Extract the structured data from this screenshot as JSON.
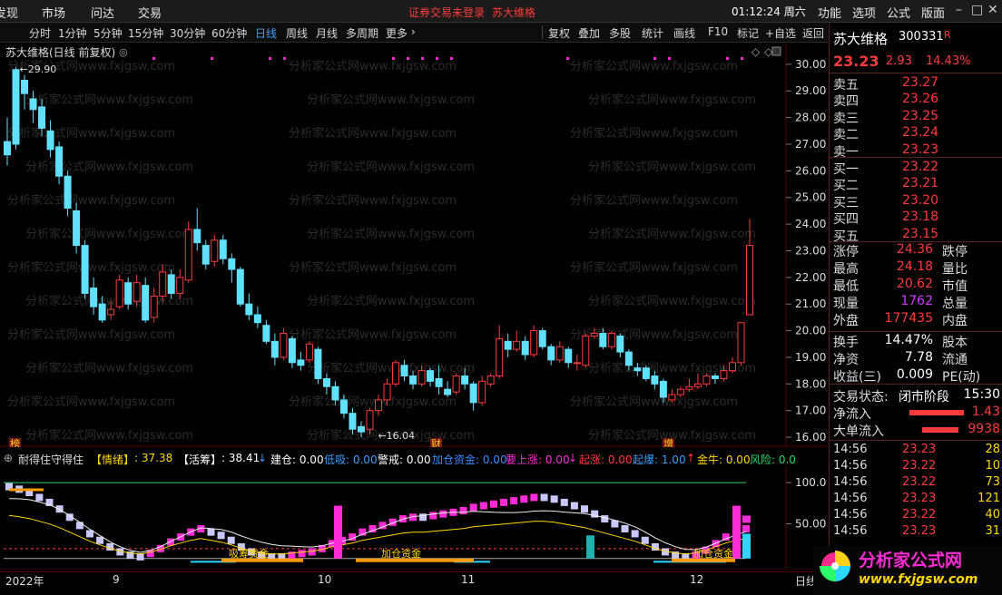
{
  "topbar": {
    "menus": [
      "发现",
      "市场",
      "问达",
      "交易"
    ],
    "center_login": "证券交易未登录",
    "center_stock": "苏大维格",
    "time": "01:12:24 周六",
    "right_menus": [
      "功能",
      "选项",
      "公式",
      "版面"
    ],
    "window_controls": [
      "minimize-icon",
      "maximize-icon",
      "close-icon"
    ]
  },
  "periods": [
    "分时",
    "1分钟",
    "5分钟",
    "15分钟",
    "30分钟",
    "60分钟",
    "日线",
    "周线",
    "月线",
    "多周期",
    "更多"
  ],
  "active_period": "日线",
  "tools": [
    "复权",
    "叠加",
    "多股",
    "统计",
    "画线",
    "F10",
    "标记",
    "+自选",
    "返回"
  ],
  "chart": {
    "title": "苏大维格(日线 前复权)",
    "high_label": "29.90",
    "low_label": "16.04",
    "y_ticks": [
      "30.00",
      "29.00",
      "28.00",
      "27.00",
      "26.00",
      "25.00",
      "24.00",
      "23.00",
      "22.00",
      "21.00",
      "20.00",
      "19.00",
      "18.00",
      "17.00",
      "16.00"
    ],
    "event_markers": [
      "榜",
      "财",
      "增"
    ],
    "watermark": "分析家公式网www.fxjgsw.com"
  },
  "indicator": {
    "name": "耐得住守得住",
    "qingxu_label": "【情绪】",
    "qingxu_value": ": 37.38",
    "huochou_label": "【活筹】",
    "huochou_value": ": 38.41",
    "jiancang": "建仓: 0.00",
    "dixi": "低吸: 0.00",
    "jingjie": "警戒: 0.00",
    "zhuli": "加仓资金: 0.00",
    "yaoshangzhang": "要上涨: 0.00",
    "qizhang": "起涨: 0.00",
    "qibao": "起爆: 1.00",
    "jinniu": "金牛: 0.00",
    "fengxian": "风险: 0.0",
    "y_ticks": [
      "100.0",
      "50.00"
    ],
    "annotations": [
      "吸筹资金",
      "加仓资金",
      "加仓资金"
    ]
  },
  "xaxis": {
    "labels": [
      "2022年",
      "9",
      "10",
      "11",
      "12"
    ],
    "right_label": "日线"
  },
  "quote": {
    "name": "苏大维格",
    "code": "300331",
    "flag": "R",
    "price": "23.23",
    "change": "2.93",
    "pct": "14.43%",
    "asks": [
      {
        "label": "卖五",
        "price": "23.27"
      },
      {
        "label": "卖四",
        "price": "23.26"
      },
      {
        "label": "卖三",
        "price": "23.25"
      },
      {
        "label": "卖二",
        "price": "23.24"
      },
      {
        "label": "卖一",
        "price": "23.23"
      }
    ],
    "bids": [
      {
        "label": "买一",
        "price": "23.22"
      },
      {
        "label": "买二",
        "price": "23.21"
      },
      {
        "label": "买三",
        "price": "23.20"
      },
      {
        "label": "买四",
        "price": "23.18"
      },
      {
        "label": "买五",
        "price": "23.15"
      }
    ],
    "stats": [
      {
        "label": "涨停",
        "value": "24.36",
        "label2": "跌停",
        "color": "red"
      },
      {
        "label": "最高",
        "value": "24.18",
        "label2": "量比",
        "color": "red"
      },
      {
        "label": "最低",
        "value": "20.62",
        "label2": "市值",
        "color": "red"
      },
      {
        "label": "现量",
        "value": "1762",
        "label2": "总量",
        "color": "purple"
      },
      {
        "label": "外盘",
        "value": "177435",
        "label2": "内盘",
        "color": "red"
      }
    ],
    "stats2": [
      {
        "label": "换手",
        "value": "14.47%",
        "label2": "股本"
      },
      {
        "label": "净资",
        "value": "7.78",
        "label2": "流通"
      },
      {
        "label": "收益(三)",
        "value": "0.009",
        "label2": "PE(动)"
      }
    ],
    "trade_status_label": "交易状态:",
    "trade_status": "闭市阶段",
    "trade_time": "15:30",
    "net_inflow_label": "净流入",
    "net_inflow": "1.43",
    "big_inflow_label": "大单流入",
    "big_inflow": "9938",
    "ticks": [
      {
        "t": "14:56",
        "p": "23.23",
        "q": "28"
      },
      {
        "t": "14:56",
        "p": "23.22",
        "q": "10"
      },
      {
        "t": "14:56",
        "p": "23.22",
        "q": "73"
      },
      {
        "t": "14:56",
        "p": "23.23",
        "q": "121"
      },
      {
        "t": "14:56",
        "p": "23.22",
        "q": "40"
      },
      {
        "t": "14:56",
        "p": "23.23",
        "q": "31"
      }
    ]
  },
  "logo": {
    "text": "分析家公式网",
    "url": "www.fxjgsw.com"
  },
  "colors": {
    "up": "#ff3b3b",
    "down": "#5fe1ff",
    "accent": "#3aa0ff",
    "magenta": "#ff2bd6",
    "lavender": "#c8c8ff"
  },
  "chart_data": {
    "type": "candlestick",
    "y_range": [
      15.9,
      30.2
    ],
    "candles": [
      [
        27.1,
        26.6,
        28.0,
        26.2
      ],
      [
        29.8,
        27.0,
        29.9,
        26.8
      ],
      [
        29.4,
        28.9,
        29.6,
        28.3
      ],
      [
        28.7,
        28.3,
        29.0,
        27.8
      ],
      [
        28.4,
        27.6,
        28.7,
        27.3
      ],
      [
        27.5,
        26.8,
        27.9,
        26.5
      ],
      [
        26.9,
        25.8,
        27.1,
        25.5
      ],
      [
        25.8,
        24.6,
        26.0,
        24.3
      ],
      [
        24.5,
        23.2,
        24.8,
        22.9
      ],
      [
        23.2,
        21.4,
        23.4,
        21.2
      ],
      [
        21.6,
        20.9,
        22.0,
        20.6
      ],
      [
        21.0,
        20.4,
        21.3,
        20.3
      ],
      [
        20.6,
        20.8,
        21.1,
        20.4
      ],
      [
        20.9,
        21.9,
        22.1,
        20.8
      ],
      [
        21.8,
        21.0,
        22.0,
        20.8
      ],
      [
        21.1,
        21.8,
        22.1,
        20.9
      ],
      [
        21.7,
        20.4,
        22.0,
        20.3
      ],
      [
        20.5,
        21.3,
        21.6,
        20.3
      ],
      [
        21.3,
        22.2,
        22.5,
        21.1
      ],
      [
        22.1,
        21.4,
        22.3,
        21.2
      ],
      [
        21.4,
        22.0,
        22.3,
        21.2
      ],
      [
        21.9,
        23.8,
        24.1,
        21.8
      ],
      [
        23.8,
        23.3,
        24.6,
        23.0
      ],
      [
        23.2,
        22.5,
        23.4,
        22.3
      ],
      [
        22.6,
        23.4,
        23.6,
        22.4
      ],
      [
        23.4,
        22.7,
        23.6,
        22.5
      ],
      [
        22.7,
        22.3,
        22.9,
        21.8
      ],
      [
        22.3,
        21.0,
        22.4,
        20.9
      ],
      [
        21.0,
        20.6,
        21.4,
        20.4
      ],
      [
        20.6,
        20.3,
        20.9,
        20.1
      ],
      [
        20.2,
        19.6,
        20.4,
        19.5
      ],
      [
        19.6,
        19.0,
        19.9,
        18.7
      ],
      [
        19.0,
        19.9,
        20.1,
        18.9
      ],
      [
        19.7,
        18.8,
        19.8,
        18.6
      ],
      [
        18.9,
        18.7,
        19.2,
        18.5
      ],
      [
        18.9,
        19.5,
        19.6,
        18.8
      ],
      [
        19.3,
        18.2,
        19.4,
        18.0
      ],
      [
        18.2,
        17.9,
        18.4,
        17.6
      ],
      [
        17.9,
        17.4,
        18.1,
        17.2
      ],
      [
        17.4,
        16.9,
        17.6,
        16.7
      ],
      [
        16.9,
        16.3,
        17.1,
        16.1
      ],
      [
        16.4,
        16.2,
        16.6,
        16.0
      ],
      [
        16.3,
        17.0,
        17.1,
        16.1
      ],
      [
        17.0,
        17.4,
        17.6,
        16.8
      ],
      [
        17.4,
        18.0,
        18.2,
        17.2
      ],
      [
        18.0,
        18.8,
        18.9,
        17.9
      ],
      [
        18.7,
        18.3,
        18.9,
        18.1
      ],
      [
        18.3,
        18.0,
        18.5,
        17.8
      ],
      [
        18.0,
        18.5,
        18.7,
        17.9
      ],
      [
        18.5,
        18.1,
        18.6,
        17.9
      ],
      [
        18.2,
        17.9,
        18.7,
        17.6
      ],
      [
        17.8,
        17.6,
        18.1,
        17.5
      ],
      [
        17.7,
        18.3,
        18.4,
        17.6
      ],
      [
        18.3,
        18.0,
        18.6,
        17.8
      ],
      [
        18.0,
        17.3,
        18.1,
        17.0
      ],
      [
        17.3,
        18.1,
        18.3,
        17.2
      ],
      [
        18.0,
        18.3,
        18.4,
        17.9
      ],
      [
        18.3,
        19.7,
        20.2,
        18.2
      ],
      [
        19.6,
        19.3,
        19.9,
        19.0
      ],
      [
        19.3,
        19.6,
        20.0,
        19.2
      ],
      [
        19.6,
        19.1,
        19.8,
        18.9
      ],
      [
        19.1,
        20.0,
        20.2,
        19.0
      ],
      [
        20.0,
        19.4,
        20.1,
        19.3
      ],
      [
        19.4,
        18.9,
        19.5,
        18.7
      ],
      [
        18.9,
        19.4,
        19.6,
        18.8
      ],
      [
        19.3,
        18.8,
        19.4,
        18.6
      ],
      [
        18.8,
        18.8,
        19.1,
        18.5
      ],
      [
        18.7,
        19.8,
        19.9,
        18.6
      ],
      [
        19.8,
        19.9,
        20.1,
        19.7
      ],
      [
        19.9,
        19.4,
        20.1,
        19.3
      ],
      [
        19.4,
        19.9,
        20.0,
        19.3
      ],
      [
        19.8,
        19.2,
        19.9,
        19.0
      ],
      [
        19.2,
        18.7,
        19.3,
        18.5
      ],
      [
        18.6,
        18.5,
        18.8,
        18.3
      ],
      [
        18.6,
        18.2,
        18.7,
        18.1
      ],
      [
        18.3,
        18.0,
        18.5,
        17.8
      ],
      [
        18.1,
        17.5,
        18.2,
        17.3
      ],
      [
        17.4,
        17.6,
        17.8,
        17.3
      ],
      [
        17.6,
        17.8,
        17.9,
        17.5
      ],
      [
        17.8,
        17.9,
        18.2,
        17.7
      ],
      [
        17.9,
        18.0,
        18.4,
        17.8
      ],
      [
        18.0,
        18.3,
        18.4,
        17.9
      ],
      [
        18.3,
        18.2,
        18.4,
        18.0
      ],
      [
        18.2,
        18.5,
        18.7,
        18.1
      ],
      [
        18.5,
        18.8,
        19.0,
        18.4
      ],
      [
        18.8,
        20.3,
        20.3,
        18.7
      ],
      [
        20.6,
        23.2,
        24.2,
        20.6
      ]
    ]
  }
}
